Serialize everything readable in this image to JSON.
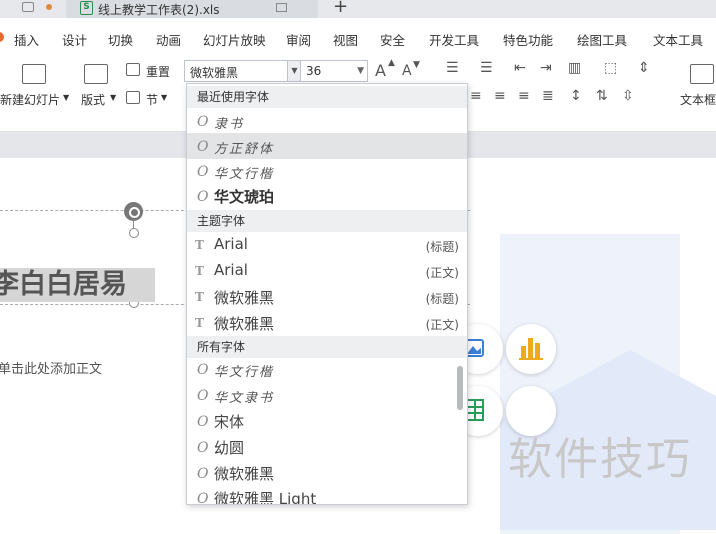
{
  "window": {
    "doc_tab_title": "线上教学工作表(2).xls",
    "new_tab_symbol": "+"
  },
  "ribbon": {
    "tabs": [
      "插入",
      "设计",
      "切换",
      "动画",
      "幻灯片放映",
      "审阅",
      "视图",
      "安全",
      "开发工具",
      "特色功能",
      "绘图工具",
      "文本工具"
    ]
  },
  "toolbar": {
    "new_slide_label": "新建幻灯片",
    "layout_label": "版式",
    "reset_label": "重置",
    "section_label": "节",
    "font_name": "微软雅黑",
    "font_size": "36",
    "textbox_label": "文本框",
    "grow_font": "A",
    "shrink_font": "A"
  },
  "slide": {
    "title_text": "李白白居易",
    "body_placeholder": "单击此处添加正文",
    "watermark": "软件技巧"
  },
  "font_dropdown": {
    "sections": [
      {
        "header": "最近使用字体",
        "items": [
          {
            "name": "隶书",
            "icon": "O",
            "tag": ""
          },
          {
            "name": "方正舒体",
            "icon": "O",
            "tag": ""
          },
          {
            "name": "华文行楷",
            "icon": "O",
            "tag": ""
          },
          {
            "name": "华文琥珀",
            "icon": "O",
            "tag": ""
          }
        ]
      },
      {
        "header": "主题字体",
        "items": [
          {
            "name": "Arial",
            "icon": "T",
            "tag": "(标题)"
          },
          {
            "name": "Arial",
            "icon": "T",
            "tag": "(正文)"
          },
          {
            "name": "微软雅黑",
            "icon": "T",
            "tag": "(标题)"
          },
          {
            "name": "微软雅黑",
            "icon": "T",
            "tag": "(正文)"
          }
        ]
      },
      {
        "header": "所有字体",
        "items": [
          {
            "name": "华文行楷",
            "icon": "O",
            "tag": ""
          },
          {
            "name": "华文隶书",
            "icon": "O",
            "tag": ""
          },
          {
            "name": "宋体",
            "icon": "O",
            "tag": ""
          },
          {
            "name": "幼圆",
            "icon": "O",
            "tag": ""
          },
          {
            "name": "微软雅黑",
            "icon": "O",
            "tag": ""
          },
          {
            "name": "微软雅黑 Light",
            "icon": "O",
            "tag": ""
          }
        ]
      }
    ]
  }
}
